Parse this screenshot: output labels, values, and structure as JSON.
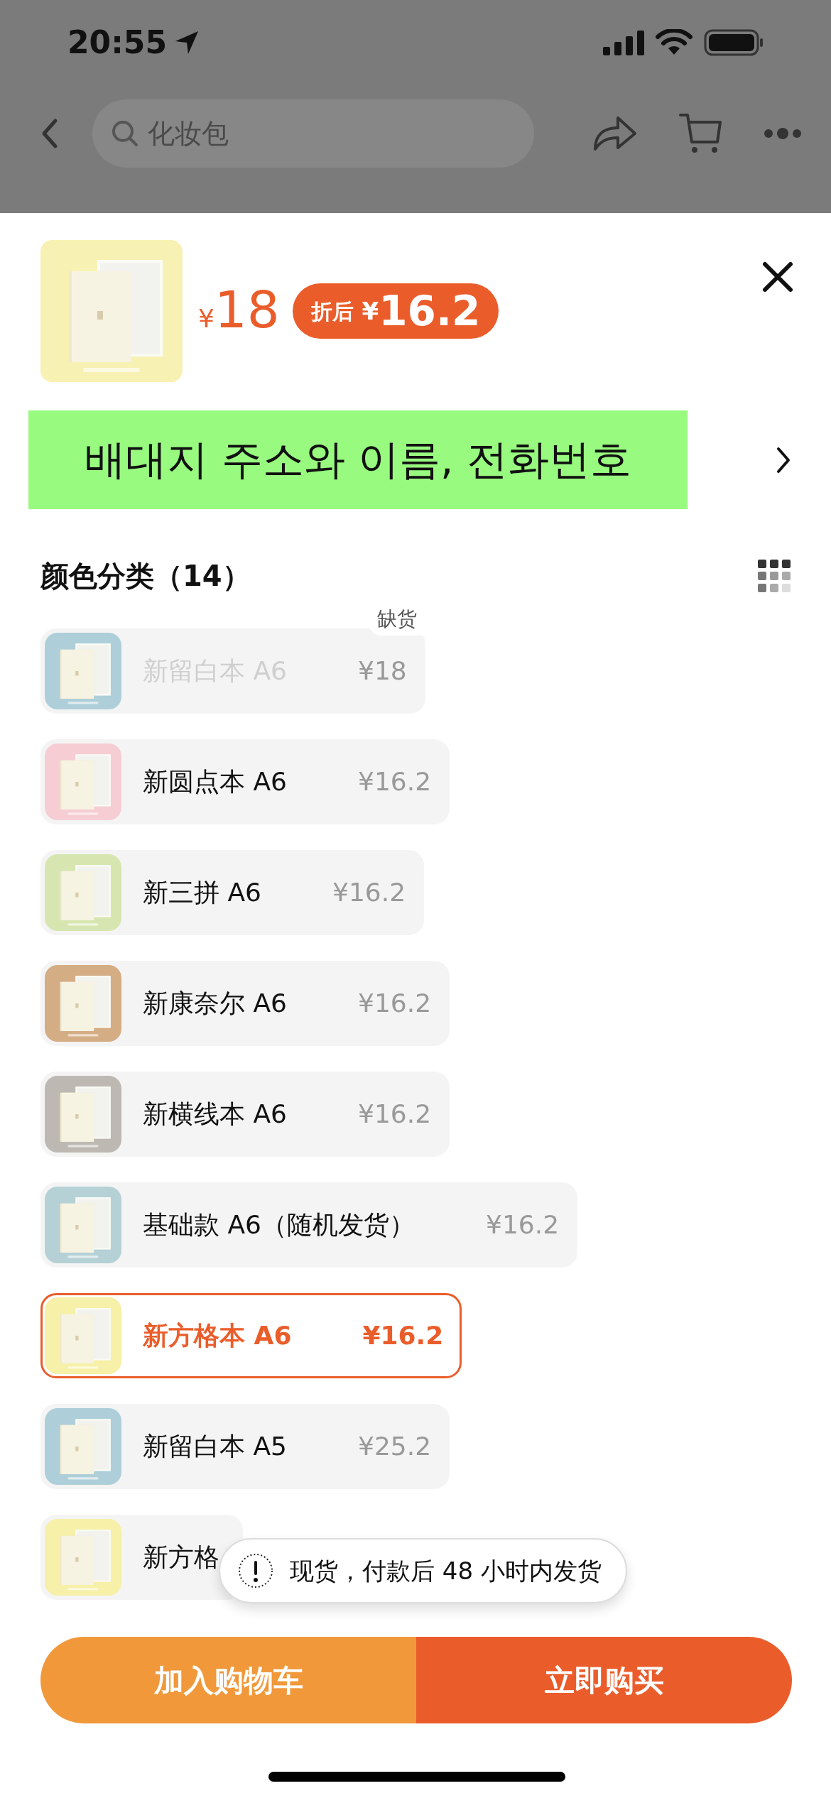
{
  "status_bar": {
    "time": "20:55"
  },
  "nav": {
    "search": {
      "placeholder": "化妆包"
    }
  },
  "product": {
    "price_symbol": "¥",
    "price": "18",
    "discount": {
      "label": "折后",
      "symbol": "¥",
      "price": "16.2"
    }
  },
  "address_banner": {
    "text": "배대지 주소와 이름, 전화번호"
  },
  "section": {
    "title": "颜色分类（14）"
  },
  "options": [
    {
      "name": "新留白本 A6",
      "price": "¥18",
      "selected": false,
      "disabled": true,
      "tag": "缺货",
      "color": "#aecfd9"
    },
    {
      "name": "新圆点本 A6",
      "price": "¥16.2",
      "selected": false,
      "disabled": false,
      "color": "#f5cdd3"
    },
    {
      "name": "新三拼 A6",
      "price": "¥16.2",
      "selected": false,
      "disabled": false,
      "color": "#d7e6b0"
    },
    {
      "name": "新康奈尔 A6",
      "price": "¥16.2",
      "selected": false,
      "disabled": false,
      "color": "#d4ad85"
    },
    {
      "name": "新横线本 A6",
      "price": "¥16.2",
      "selected": false,
      "disabled": false,
      "color": "#bdb9b2"
    },
    {
      "name": "基础款 A6（随机发货）",
      "price": "¥16.2",
      "selected": false,
      "disabled": false,
      "color": "#b5d1d6"
    },
    {
      "name": "新方格本 A6",
      "price": "¥16.2",
      "selected": true,
      "disabled": false,
      "color": "#f6f0a8"
    },
    {
      "name": "新留白本 A5",
      "price": "¥25.2",
      "selected": false,
      "disabled": false,
      "color": "#aecfd9"
    },
    {
      "name": "新方格",
      "selected": false,
      "disabled": false,
      "color": "#f6f0a8"
    }
  ],
  "toast": {
    "text": "现货，付款后 48 小时内发货"
  },
  "buttons": [
    {
      "kind": "cart",
      "label": "加入购物车"
    },
    {
      "kind": "buy",
      "label": "立即购买"
    }
  ]
}
